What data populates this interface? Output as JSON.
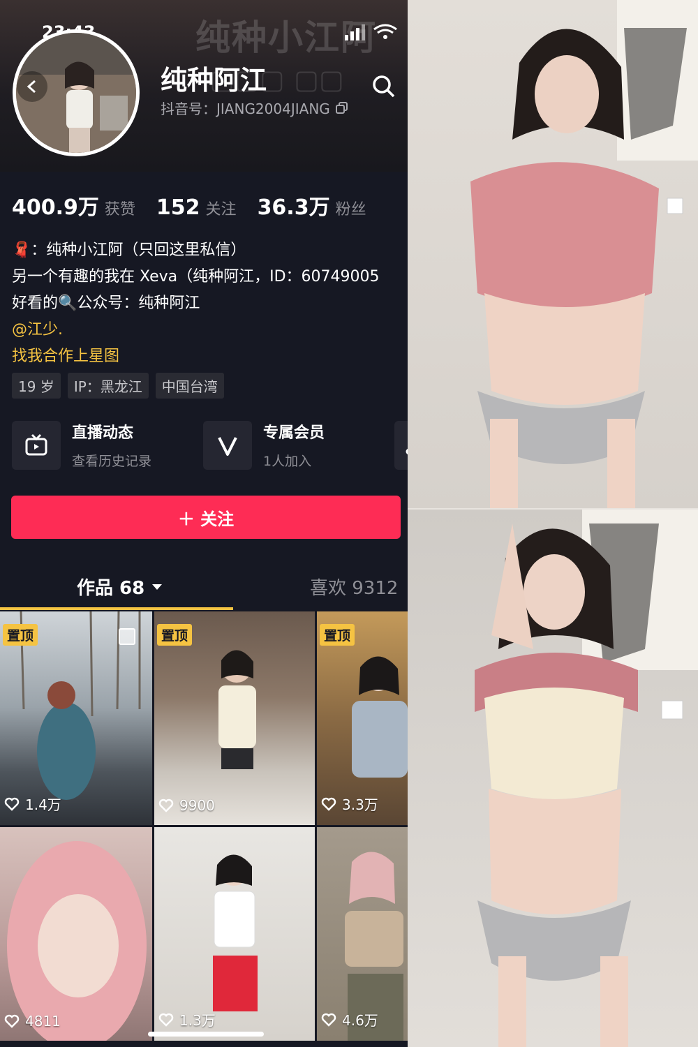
{
  "status": {
    "time": "23:43"
  },
  "header": {
    "bg_name": "纯种小江阿",
    "username": "纯种阿江",
    "douyin_id": "抖音号：JIANG2004JIANG"
  },
  "stats": [
    {
      "num": "400.9万",
      "label": "获赞"
    },
    {
      "num": "152",
      "label": "关注"
    },
    {
      "num": "36.3万",
      "label": "粉丝"
    }
  ],
  "bio": {
    "line1": "🧣：纯种小江阿（只回这里私信）",
    "line2": "另一个有趣的我在 Xeva（纯种阿江，ID：60749005",
    "line3": "好看的🔍公众号：纯种阿江",
    "mention": "@江少.",
    "link": "找我合作上星图"
  },
  "tags": [
    "19 岁",
    "IP：黑龙江",
    "中国台湾"
  ],
  "features": [
    {
      "title": "直播动态",
      "sub": "查看历史记录",
      "icon": "tv-icon"
    },
    {
      "title": "专属会员",
      "sub": "1人加入",
      "icon": "v-icon"
    },
    {
      "title": "",
      "sub": "",
      "icon": "music-icon"
    }
  ],
  "follow_label": "＋ 关注",
  "tabs": {
    "works": "作品 68",
    "likes": "喜欢 9312"
  },
  "grid": [
    {
      "pinned": true,
      "pin_label": "置顶",
      "likes": "1.4万"
    },
    {
      "pinned": true,
      "pin_label": "置顶",
      "likes": "9900"
    },
    {
      "pinned": true,
      "pin_label": "置顶",
      "likes": "3.3万"
    },
    {
      "pinned": false,
      "pin_label": "",
      "likes": "4811"
    },
    {
      "pinned": false,
      "pin_label": "",
      "likes": "1.3万"
    },
    {
      "pinned": false,
      "pin_label": "",
      "likes": "4.6万"
    }
  ],
  "colors": {
    "accent": "#fe2c55",
    "highlight": "#f5c342",
    "bg": "#161823"
  }
}
